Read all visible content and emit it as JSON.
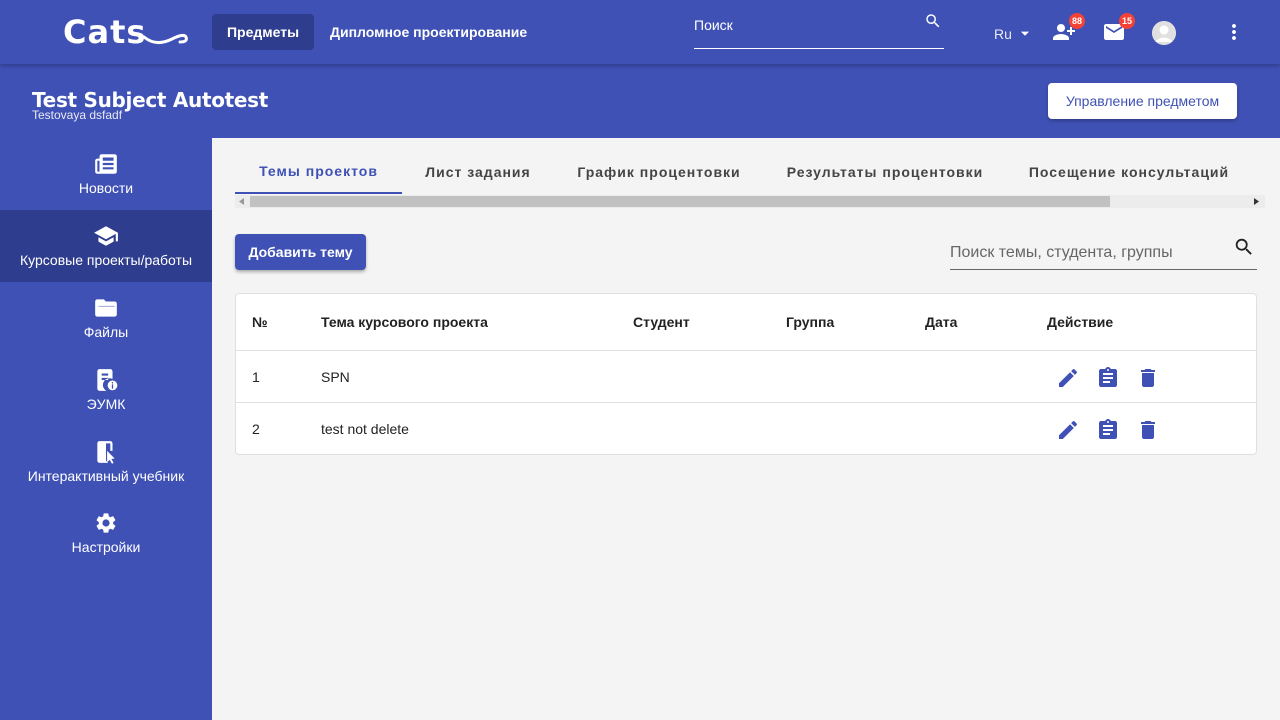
{
  "app": {
    "logo_text": "Cats"
  },
  "topnav": {
    "subjects_label": "Предметы",
    "diploma_label": "Дипломное проектирование",
    "search_placeholder": "Поиск",
    "language": "Ru",
    "notifications_count": "88",
    "messages_count": "15"
  },
  "subject": {
    "title": "Test Subject Autotest",
    "subtitle": "Testovaya dsfadf",
    "manage_label": "Управление предметом"
  },
  "sidebar": {
    "items": [
      {
        "label": "Новости",
        "icon": "news-icon"
      },
      {
        "label": "Курсовые проекты/работы",
        "icon": "school-icon"
      },
      {
        "label": "Файлы",
        "icon": "folder-icon"
      },
      {
        "label": "ЭУМК",
        "icon": "book-info-icon"
      },
      {
        "label": "Интерактивный учебник",
        "icon": "interactive-book-icon"
      },
      {
        "label": "Настройки",
        "icon": "gear-icon"
      }
    ]
  },
  "tabs": [
    {
      "label": "Темы проектов"
    },
    {
      "label": "Лист задания"
    },
    {
      "label": "График процентовки"
    },
    {
      "label": "Результаты процентовки"
    },
    {
      "label": "Посещение консультаций"
    }
  ],
  "toolbar": {
    "add_label": "Добавить тему",
    "search_placeholder": "Поиск темы, студента, группы"
  },
  "table": {
    "headers": [
      "№",
      "Тема курсового проекта",
      "Студент",
      "Группа",
      "Дата",
      "Действие"
    ],
    "rows": [
      {
        "num": "1",
        "topic": "SPN",
        "student": "",
        "group": "",
        "date": ""
      },
      {
        "num": "2",
        "topic": "test not delete",
        "student": "",
        "group": "",
        "date": ""
      }
    ]
  },
  "colors": {
    "primary": "#3f51b5",
    "primary_dark": "#2f3d8e",
    "badge": "#f44336",
    "background": "#f4f4f4"
  }
}
